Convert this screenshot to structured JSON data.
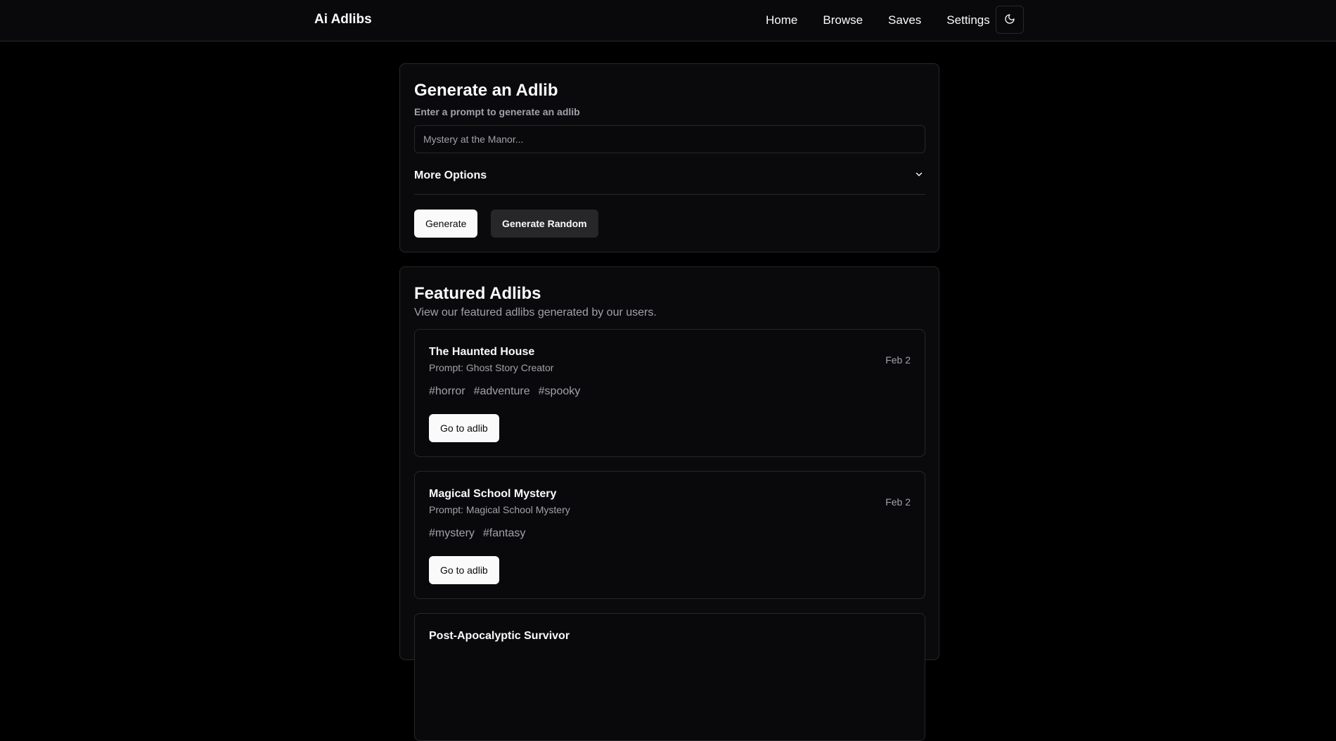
{
  "header": {
    "brand": "Ai Adlibs",
    "nav": [
      {
        "label": "Home"
      },
      {
        "label": "Browse"
      },
      {
        "label": "Saves"
      },
      {
        "label": "Settings"
      }
    ],
    "theme_icon": "moon-icon"
  },
  "generate": {
    "title": "Generate an Adlib",
    "subtitle": "Enter a prompt to generate an adlib",
    "input_placeholder": "Mystery at the Manor...",
    "input_value": "",
    "more_options_label": "More Options",
    "more_options_icon": "chevron-down-icon",
    "generate_label": "Generate",
    "generate_random_label": "Generate Random"
  },
  "featured": {
    "title": "Featured Adlibs",
    "subtitle": "View our featured adlibs generated by our users.",
    "items": [
      {
        "title": "The Haunted House",
        "prompt": "Prompt: Ghost Story Creator",
        "date": "Feb 2",
        "tags": [
          "#horror",
          "#adventure",
          "#spooky"
        ],
        "button": "Go to adlib"
      },
      {
        "title": "Magical School Mystery",
        "prompt": "Prompt: Magical School Mystery",
        "date": "Feb 2",
        "tags": [
          "#mystery",
          "#fantasy"
        ],
        "button": "Go to adlib"
      },
      {
        "title": "Post-Apocalyptic Survivor",
        "prompt": "",
        "date": "",
        "tags": [],
        "button": ""
      }
    ]
  },
  "colors": {
    "background": "#000000",
    "card": "#0a0a0c",
    "border": "#27272a",
    "text": "#fafafa",
    "muted": "#a1a1aa"
  }
}
